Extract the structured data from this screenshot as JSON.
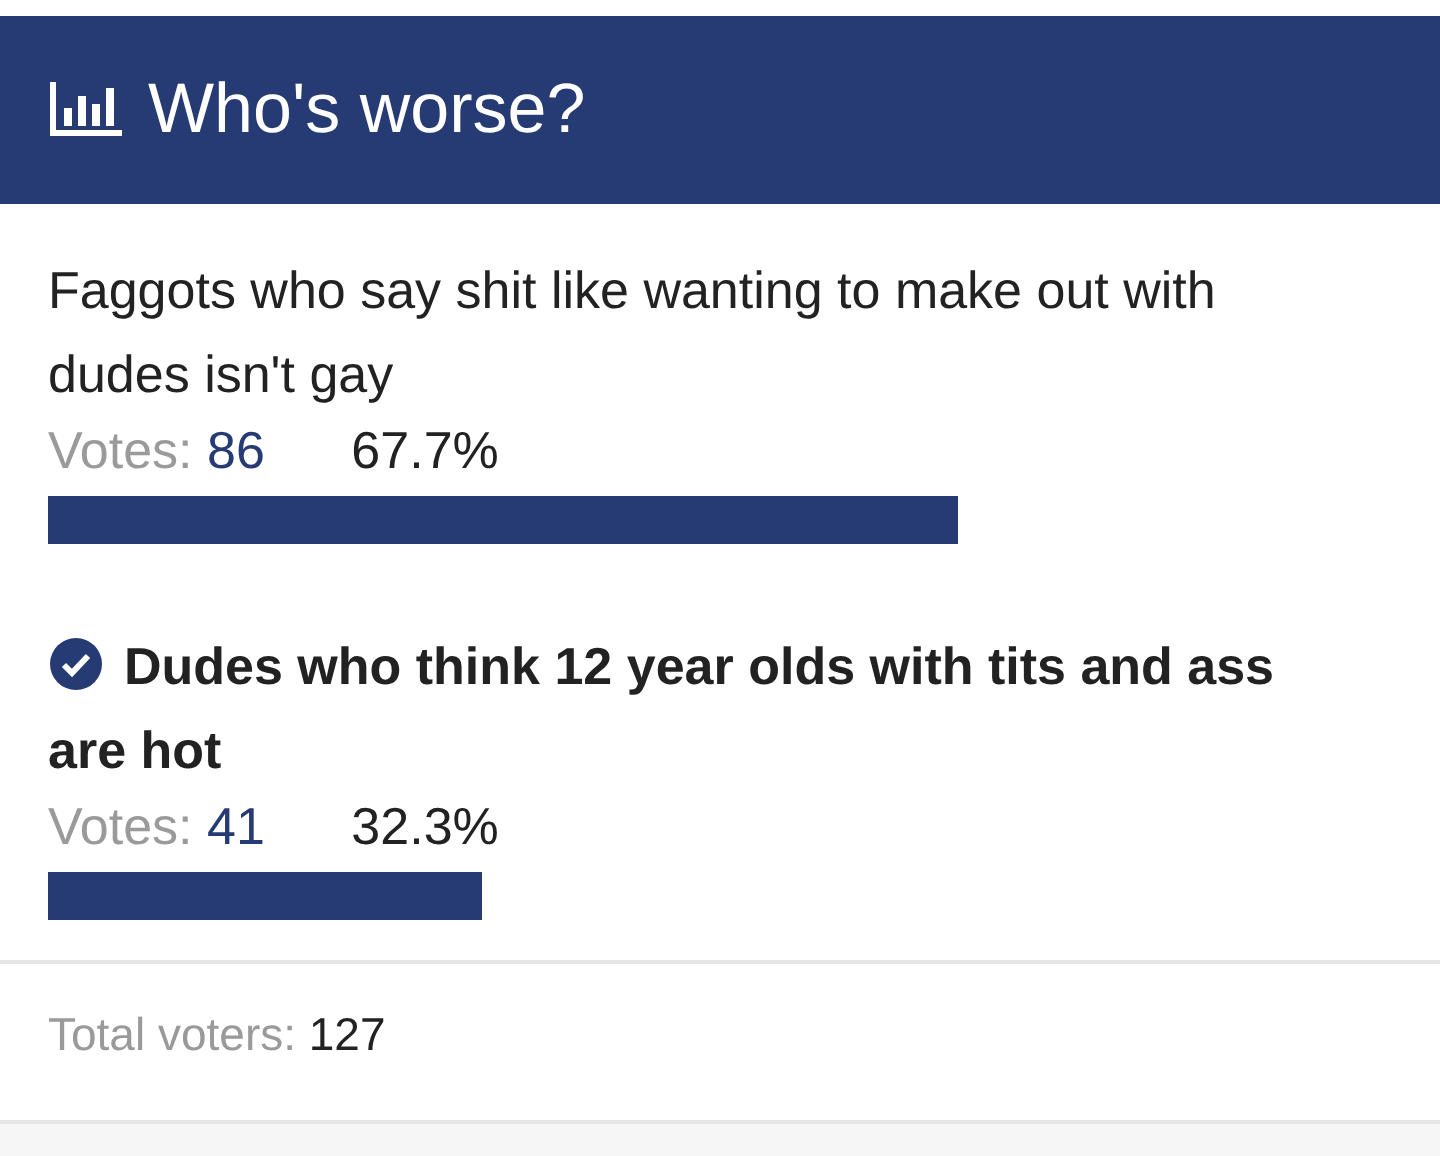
{
  "poll": {
    "title": "Who's worse?",
    "options": [
      {
        "text": "Faggots who say shit like wanting to make out with dudes isn't gay",
        "selected": false,
        "votes_label": "Votes:",
        "votes": "86",
        "percent": "67.7%",
        "level": 0.677
      },
      {
        "text": "Dudes who think 12 year olds with tits and ass are hot",
        "selected": true,
        "votes_label": "Votes:",
        "votes": "41",
        "percent": "32.3%",
        "level": 0.323
      }
    ],
    "total_label": "Total voters:",
    "total": "127"
  }
}
